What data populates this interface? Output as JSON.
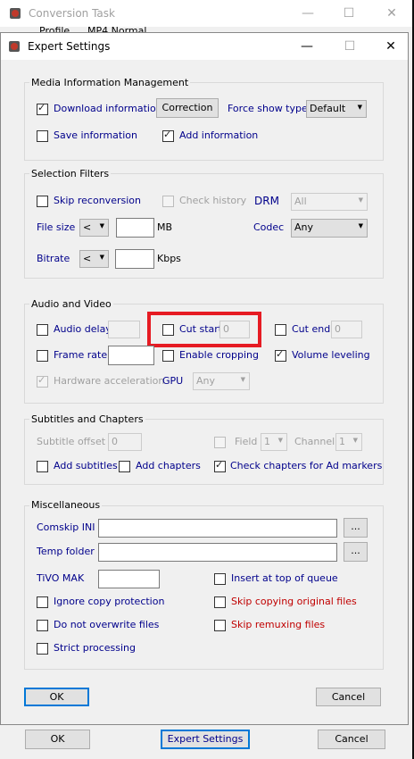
{
  "bg_window": {
    "title": "Conversion Task",
    "partial_row_label": "Profile",
    "partial_row_value": "MP4 Normal",
    "ok_label": "OK",
    "expert_label": "Expert Settings",
    "cancel_label": "Cancel"
  },
  "dialog": {
    "title": "Expert Settings",
    "media": {
      "legend": "Media Information Management",
      "download_info": "Download information",
      "correction": "Correction",
      "force_show_type": "Force show type",
      "force_show_type_value": "Default",
      "save_info": "Save information",
      "add_info": "Add information"
    },
    "filters": {
      "legend": "Selection Filters",
      "skip_reconversion": "Skip reconversion",
      "check_history": "Check history",
      "drm": "DRM",
      "drm_value": "All",
      "file_size": "File size",
      "file_size_op": "<",
      "file_size_value": "",
      "mb": "MB",
      "codec": "Codec",
      "codec_value": "Any",
      "bitrate": "Bitrate",
      "bitrate_op": "<",
      "bitrate_value": "",
      "kbps": "Kbps"
    },
    "av": {
      "legend": "Audio and Video",
      "audio_delay": "Audio delay",
      "audio_delay_value": "",
      "cut_start": "Cut start",
      "cut_start_value": "0",
      "cut_end": "Cut end",
      "cut_end_value": "0",
      "frame_rate": "Frame rate",
      "frame_rate_value": "",
      "enable_cropping": "Enable cropping",
      "volume_leveling": "Volume leveling",
      "hardware_acceleration": "Hardware acceleration",
      "gpu": "GPU",
      "gpu_value": "Any"
    },
    "subs": {
      "legend": "Subtitles and Chapters",
      "subtitle_offset": "Subtitle offset",
      "subtitle_offset_value": "0",
      "field": "Field",
      "field_value": "1",
      "channel": "Channel",
      "channel_value": "1",
      "add_subtitles": "Add subtitles",
      "add_chapters": "Add chapters",
      "check_chapters": "Check chapters for Ad markers"
    },
    "misc": {
      "legend": "Miscellaneous",
      "comskip_ini": "Comskip INI",
      "temp_folder": "Temp folder",
      "browse": "...",
      "tivo_mak": "TiVO MAK",
      "insert_top": "Insert at top of queue",
      "ignore_copy": "Ignore copy protection",
      "skip_copying": "Skip copying original files",
      "no_overwrite": "Do not overwrite files",
      "skip_remuxing": "Skip remuxing files",
      "strict": "Strict processing"
    },
    "ok_label": "OK",
    "cancel_label": "Cancel"
  },
  "colors": {
    "label_blue": "#00008b",
    "label_red": "#c00000",
    "highlight_red": "#e61b23",
    "disabled_gray": "#a0a0a0"
  }
}
